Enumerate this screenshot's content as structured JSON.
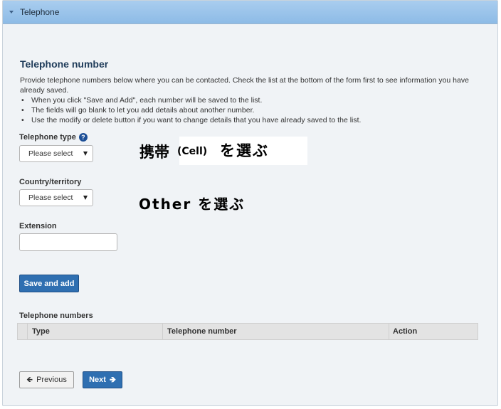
{
  "panel": {
    "title": "Telephone"
  },
  "section": {
    "title": "Telephone number",
    "intro": "Provide telephone numbers below where you can be contacted. Check the list at the bottom of the form first to see information you have already saved.",
    "bullets": [
      "When you click \"Save and Add\", each number will be saved to the list.",
      "The fields will go blank to let you add details about another number.",
      "Use the modify or delete button if you want to change details that you have already saved to the list."
    ]
  },
  "form": {
    "telephone_type": {
      "label": "Telephone type",
      "value": "Please select",
      "help_icon": "question-circle"
    },
    "country": {
      "label": "Country/territory",
      "value": "Please select"
    },
    "extension": {
      "label": "Extension",
      "value": ""
    },
    "save_button": "Save and add"
  },
  "annotations": {
    "type_prefix": "携帯",
    "type_cell": "(Cell)",
    "type_suffix": "を選ぶ",
    "country_note": "Other  を選ぶ"
  },
  "table": {
    "title": "Telephone numbers",
    "columns": [
      "",
      "Type",
      "Telephone number",
      "Action"
    ]
  },
  "nav": {
    "previous": "Previous",
    "next": "Next"
  },
  "colors": {
    "header": "#99c3ea",
    "primary_button": "#2f6fb1"
  }
}
